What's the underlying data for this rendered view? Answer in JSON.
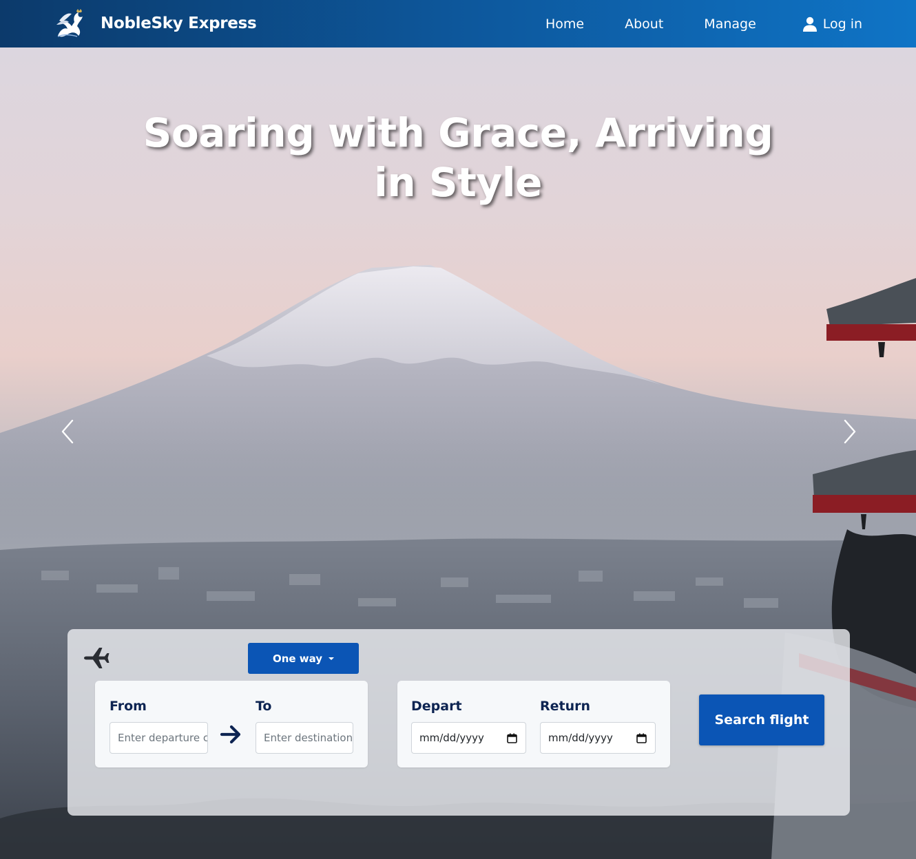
{
  "brand": {
    "name": "NobleSky Express",
    "logo_icon": "winged-horse-logo-icon"
  },
  "nav": {
    "links": [
      {
        "label": "Home"
      },
      {
        "label": "About"
      },
      {
        "label": "Manage"
      }
    ],
    "login_label": "Log in",
    "login_icon": "user-icon"
  },
  "hero": {
    "title": "Soaring with Grace, Arriving in Style",
    "prev_icon": "chevron-left-icon",
    "next_icon": "chevron-right-icon"
  },
  "booking": {
    "plane_icon": "airplane-icon",
    "trip_type": "One way",
    "from": {
      "label": "From",
      "placeholder": "Enter departure c"
    },
    "to": {
      "label": "To",
      "placeholder": "Enter destination"
    },
    "depart": {
      "label": "Depart",
      "value": "mm/dd/yyyy"
    },
    "return": {
      "label": "Return",
      "value": "mm/dd/yyyy"
    },
    "search_label": "Search flight"
  },
  "colors": {
    "nav_start": "#0c3a6b",
    "nav_end": "#0f74c6",
    "primary_button": "#0b55b5",
    "label_text": "#0d2452"
  }
}
